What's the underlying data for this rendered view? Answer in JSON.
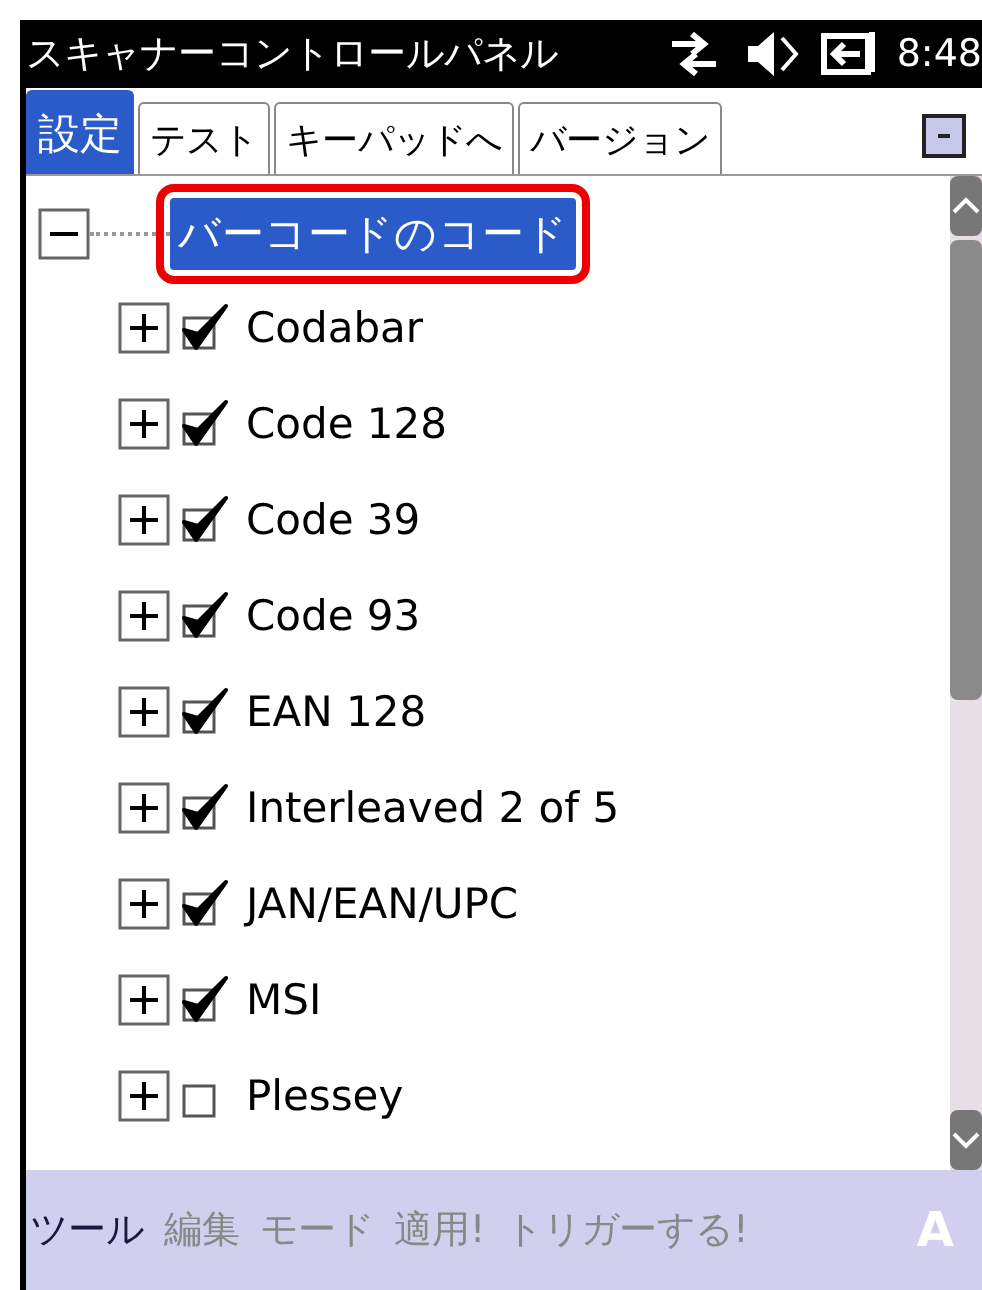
{
  "window": {
    "title": "スキャナーコントロールパネル",
    "time": "8:48"
  },
  "tabs": [
    {
      "label": "設定",
      "selected": true
    },
    {
      "label": "テスト",
      "selected": false
    },
    {
      "label": "キーパッドへ",
      "selected": false
    },
    {
      "label": "バージョン",
      "selected": false
    }
  ],
  "tree": {
    "label": "バーコードのコード",
    "expanded": true,
    "selected": true,
    "children": [
      {
        "label": "Codabar",
        "checked": true,
        "expanded": false
      },
      {
        "label": "Code 128",
        "checked": true,
        "expanded": false
      },
      {
        "label": "Code 39",
        "checked": true,
        "expanded": false
      },
      {
        "label": "Code 93",
        "checked": true,
        "expanded": false
      },
      {
        "label": "EAN 128",
        "checked": true,
        "expanded": false
      },
      {
        "label": "Interleaved 2 of 5",
        "checked": true,
        "expanded": false
      },
      {
        "label": "JAN/EAN/UPC",
        "checked": true,
        "expanded": false
      },
      {
        "label": "MSI",
        "checked": true,
        "expanded": false
      },
      {
        "label": "Plessey",
        "checked": false,
        "expanded": false
      }
    ]
  },
  "menu_bar": [
    {
      "label": "ツール",
      "disabled": false
    },
    {
      "label": "編集",
      "disabled": true
    },
    {
      "label": "モード",
      "disabled": true
    },
    {
      "label": "適用!",
      "disabled": true
    },
    {
      "label": "トリガーする!",
      "disabled": true
    }
  ],
  "input_indicator": "A"
}
